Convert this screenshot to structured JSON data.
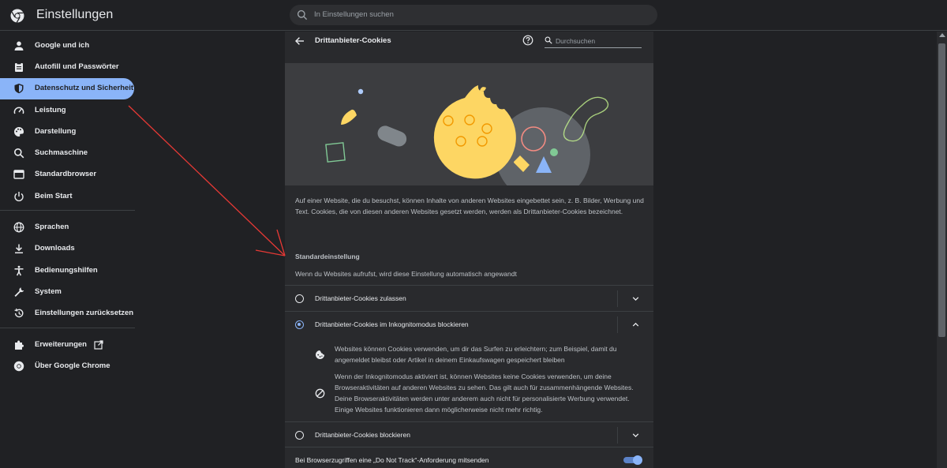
{
  "app": {
    "title": "Einstellungen"
  },
  "search": {
    "placeholder": "In Einstellungen suchen"
  },
  "sidebar": {
    "items": [
      {
        "label": "Google und ich",
        "icon": "person-icon"
      },
      {
        "label": "Autofill und Passwörter",
        "icon": "clipboard-icon"
      },
      {
        "label": "Datenschutz und Sicherheit",
        "icon": "shield-icon",
        "active": true
      },
      {
        "label": "Leistung",
        "icon": "speedometer-icon"
      },
      {
        "label": "Darstellung",
        "icon": "palette-icon"
      },
      {
        "label": "Suchmaschine",
        "icon": "search-icon"
      },
      {
        "label": "Standardbrowser",
        "icon": "browser-window-icon"
      },
      {
        "label": "Beim Start",
        "icon": "power-icon"
      },
      {
        "label": "Sprachen",
        "icon": "globe-icon"
      },
      {
        "label": "Downloads",
        "icon": "download-icon"
      },
      {
        "label": "Bedienungshilfen",
        "icon": "accessibility-icon"
      },
      {
        "label": "System",
        "icon": "wrench-icon"
      },
      {
        "label": "Einstellungen zurücksetzen",
        "icon": "restore-icon"
      },
      {
        "label": "Erweiterungen",
        "icon": "puzzle-icon"
      },
      {
        "label": "Über Google Chrome",
        "icon": "chrome-icon"
      }
    ]
  },
  "page": {
    "title": "Drittanbieter-Cookies",
    "search_placeholder": "Durchsuchen",
    "description": "Auf einer Website, die du besuchst, können Inhalte von anderen Websites eingebettet sein, z. B. Bilder, Werbung und Text. Cookies, die von diesen anderen Websites gesetzt werden, werden als Drittanbieter-Cookies bezeichnet.",
    "section_heading": "Standardeinstellung",
    "section_sub": "Wenn du Websites aufrufst, wird diese Einstellung automatisch angewandt",
    "options": [
      {
        "label": "Drittanbieter-Cookies zulassen",
        "selected": false
      },
      {
        "label": "Drittanbieter-Cookies im Inkognitomodus blockieren",
        "selected": true
      },
      {
        "label": "Drittanbieter-Cookies blockieren",
        "selected": false
      }
    ],
    "details": [
      {
        "icon": "cookie-icon",
        "text": "Websites können Cookies verwenden, um dir das Surfen zu erleichtern; zum Beispiel, damit du angemeldet bleibst oder Artikel in deinem Einkaufswagen gespeichert bleiben"
      },
      {
        "icon": "block-icon",
        "text": "Wenn der Inkognitomodus aktiviert ist, können Websites keine Cookies verwenden, um deine Browseraktivitäten auf anderen Websites zu sehen. Das gilt auch für zusammenhängende Websites. Deine Browseraktivitäten werden unter anderem auch nicht für personalisierte Werbung verwendet. Einige Websites funktionieren dann möglicherweise nicht mehr richtig."
      }
    ],
    "dnt_label": "Bei Browserzugriffen eine „Do Not Track“-Anforderung mitsenden",
    "dnt_enabled": true
  },
  "colors": {
    "accent": "#8ab4f8",
    "background": "#202124",
    "card": "#292a2d",
    "annotation": "#e53935"
  }
}
